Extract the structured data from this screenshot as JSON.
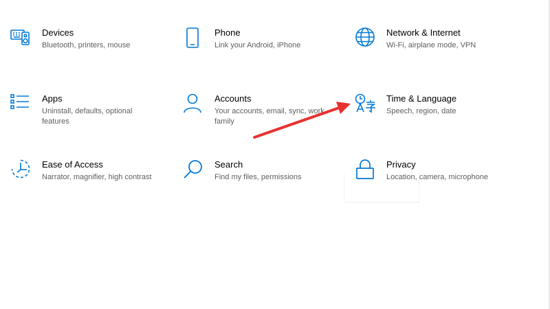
{
  "accent_color": "#0078d7",
  "annotation_color": "#e8312f",
  "tiles": [
    {
      "title": "Devices",
      "description": "Bluetooth, printers, mouse",
      "icon": "devices-icon"
    },
    {
      "title": "Phone",
      "description": "Link your Android, iPhone",
      "icon": "phone-icon"
    },
    {
      "title": "Network & Internet",
      "description": "Wi-Fi, airplane mode, VPN",
      "icon": "globe-icon"
    },
    {
      "title": "Apps",
      "description": "Uninstall, defaults, optional features",
      "icon": "apps-list-icon"
    },
    {
      "title": "Accounts",
      "description": "Your accounts, email, sync, work, family",
      "icon": "person-icon"
    },
    {
      "title": "Time & Language",
      "description": "Speech, region, date",
      "icon": "time-language-icon"
    },
    {
      "title": "Ease of Access",
      "description": "Narrator, magnifier, high contrast",
      "icon": "ease-of-access-icon"
    },
    {
      "title": "Search",
      "description": "Find my files, permissions",
      "icon": "search-icon"
    },
    {
      "title": "Privacy",
      "description": "Location, camera, microphone",
      "icon": "lock-icon"
    }
  ]
}
